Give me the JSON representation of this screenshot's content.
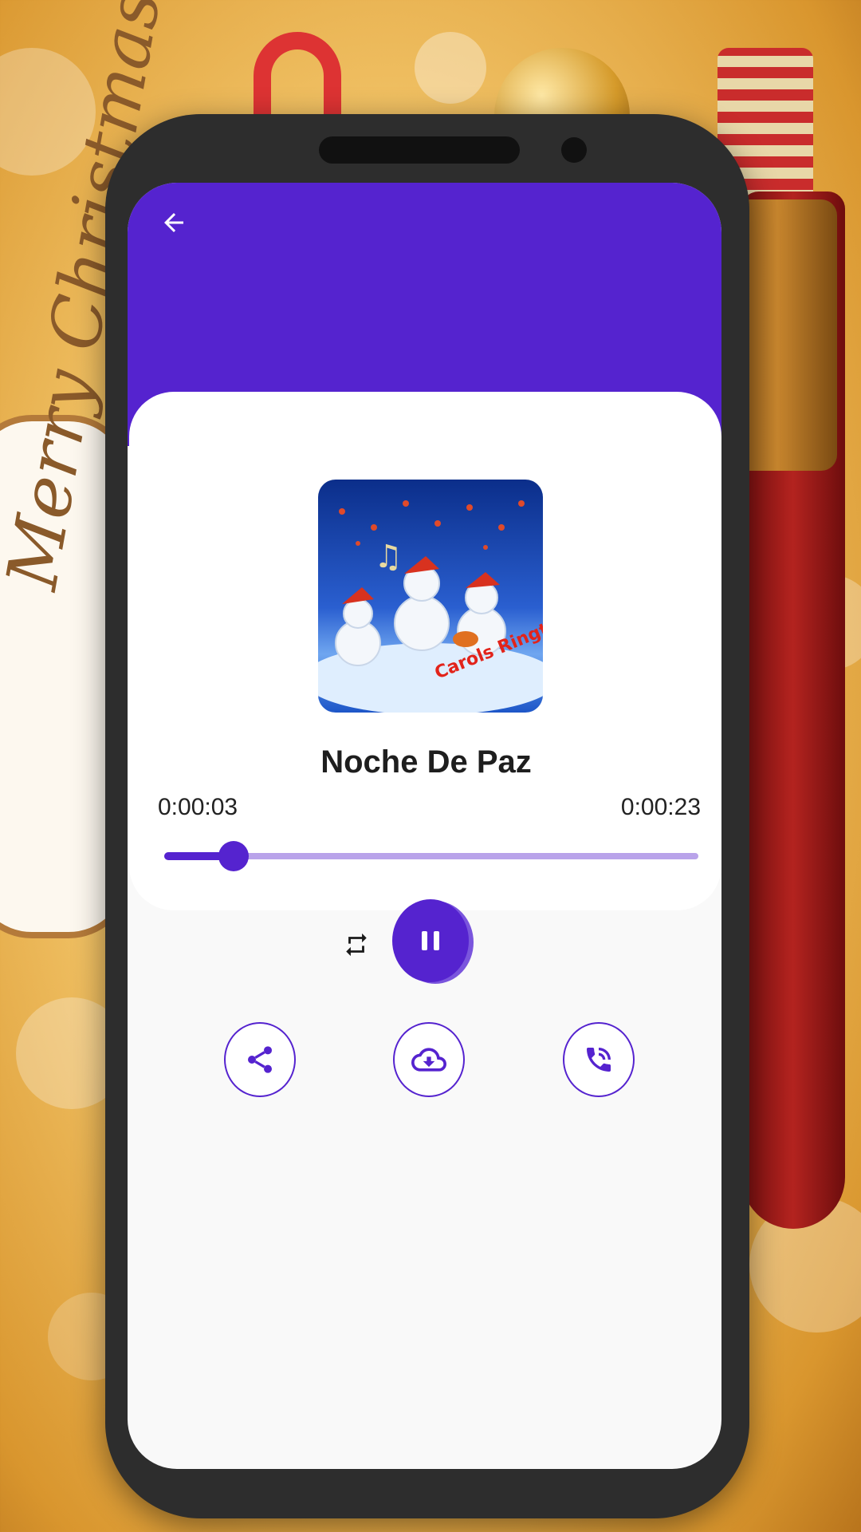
{
  "background": {
    "decor_text": "Merry Christmas"
  },
  "player": {
    "song_title": "Noche De Paz",
    "current_time": "0:00:03",
    "total_time": "0:00:23",
    "progress_fraction": 0.13,
    "album_art_text": "Carols Ringtones"
  },
  "icons": {
    "back": "arrow-left-icon",
    "repeat": "repeat-icon",
    "play_pause": "pause-icon",
    "share": "share-icon",
    "download": "cloud-download-icon",
    "ringtone": "phone-ring-icon"
  },
  "colors": {
    "accent": "#5523cf",
    "track": "#b9a3ea",
    "card": "#ffffff",
    "screen_bg": "#f9f9f9"
  }
}
